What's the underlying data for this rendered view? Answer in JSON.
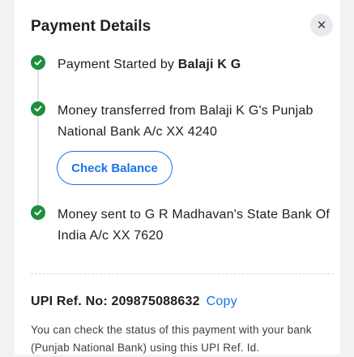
{
  "header": {
    "title": "Payment Details",
    "close_icon": "close-icon"
  },
  "steps": [
    {
      "prefix": "Payment Started by ",
      "bold": "Balaji K G",
      "status": "completed"
    },
    {
      "text": "Money transferred from Balaji K G's Punjab National Bank A/c XX 4240",
      "status": "completed"
    },
    {
      "text": "Money sent to G R Madhavan's State Bank Of India A/c XX 7620",
      "status": "completed"
    }
  ],
  "check_balance_label": "Check Balance",
  "upi": {
    "label": "UPI Ref. No: 209875088632",
    "copy_label": "Copy"
  },
  "help_text": "You can check the status of this payment with your bank (Punjab National Bank) using this UPI Ref. Id.",
  "colors": {
    "accent": "#1a73e8",
    "success": "#1e8e3e"
  }
}
